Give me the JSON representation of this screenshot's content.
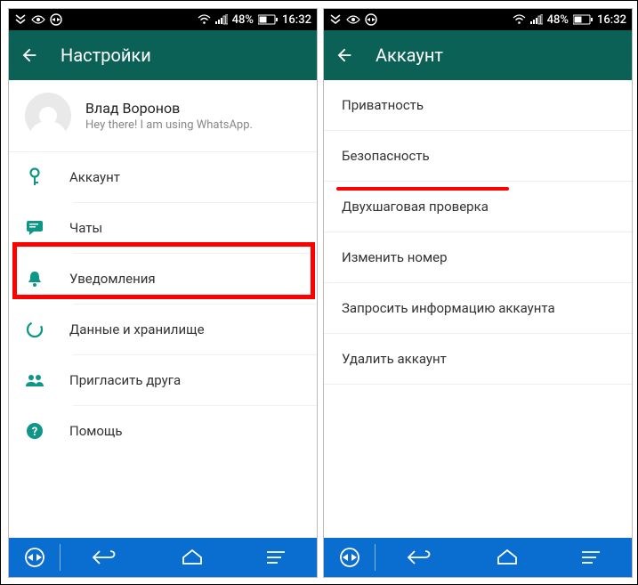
{
  "status": {
    "battery_text": "48%",
    "time": "16:32"
  },
  "left": {
    "title": "Настройки",
    "profile": {
      "name": "Влад Воронов",
      "status": "Hey there! I am using WhatsApp."
    },
    "items": [
      {
        "icon": "key-icon",
        "label": "Аккаунт"
      },
      {
        "icon": "chat-icon",
        "label": "Чаты"
      },
      {
        "icon": "bell-icon",
        "label": "Уведомления"
      },
      {
        "icon": "data-icon",
        "label": "Данные и хранилище"
      },
      {
        "icon": "people-icon",
        "label": "Пригласить друга"
      },
      {
        "icon": "help-icon",
        "label": "Помощь"
      }
    ]
  },
  "right": {
    "title": "Аккаунт",
    "items": [
      {
        "label": "Приватность"
      },
      {
        "label": "Безопасность"
      },
      {
        "label": "Двухшаговая проверка"
      },
      {
        "label": "Изменить номер"
      },
      {
        "label": "Запросить информацию аккаунта"
      },
      {
        "label": "Удалить аккаунт"
      }
    ]
  }
}
